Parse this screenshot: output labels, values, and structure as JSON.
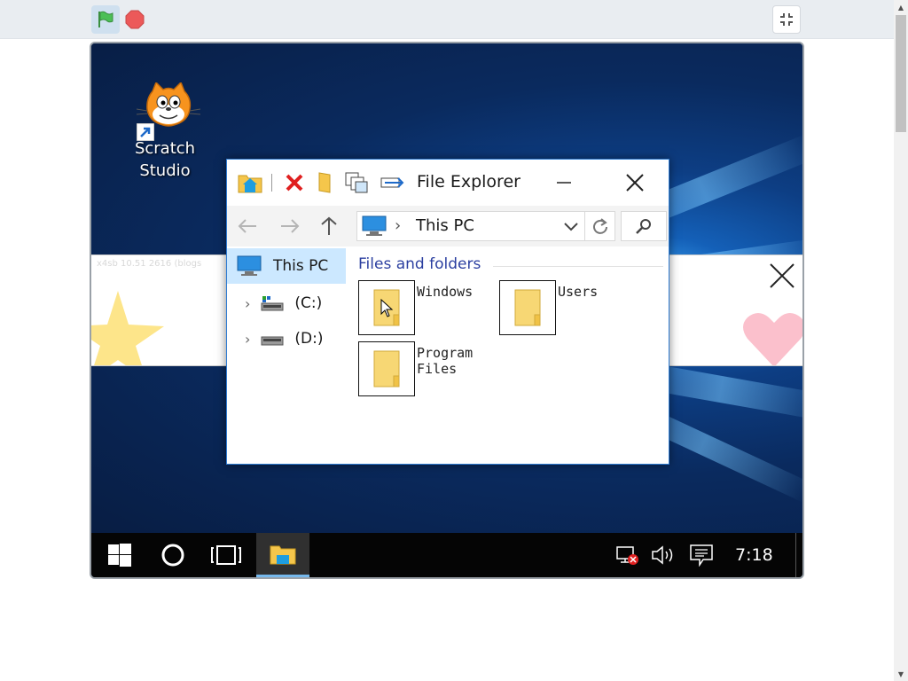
{
  "toolbar": {
    "green_flag": "green-flag-icon",
    "stop": "stop-icon",
    "fullscreen_exit": "exit-fullscreen-icon",
    "colors": {
      "flag": "#4cbf56",
      "stop": "#ec5959",
      "flag_bg": "#cfe0ef"
    }
  },
  "desktop": {
    "shortcut_label_line1": "Scratch",
    "shortcut_label_line2": "Studio",
    "shortcut_icon": "scratch-cat-icon"
  },
  "banner": {
    "faint_text": "x4sb 10.51 2616 (blogs",
    "close_icon": "close-x-icon"
  },
  "explorer": {
    "title": "File Explorer",
    "quick_access": [
      "folder-home-icon",
      "delete-icon",
      "new-folder-icon",
      "copy-icon",
      "properties-icon"
    ],
    "address": "This PC",
    "nav_pane": [
      {
        "label": "This PC",
        "selected": true,
        "icon": "computer-icon"
      },
      {
        "label": "(C:)",
        "selected": false,
        "icon": "drive-icon"
      },
      {
        "label": "(D:)",
        "selected": false,
        "icon": "drive-icon"
      }
    ],
    "group_title": "Files and folders",
    "folders": [
      {
        "label": "Windows"
      },
      {
        "label": "Users"
      },
      {
        "label": "Program\nFiles"
      }
    ]
  },
  "taskbar": {
    "time": "7:18",
    "buttons": [
      "windows-start-icon",
      "cortana-icon",
      "task-view-icon",
      "file-explorer-icon"
    ],
    "tray": [
      "network-disconnected-icon",
      "volume-icon",
      "notifications-icon"
    ],
    "accent": "#76b9ed"
  }
}
